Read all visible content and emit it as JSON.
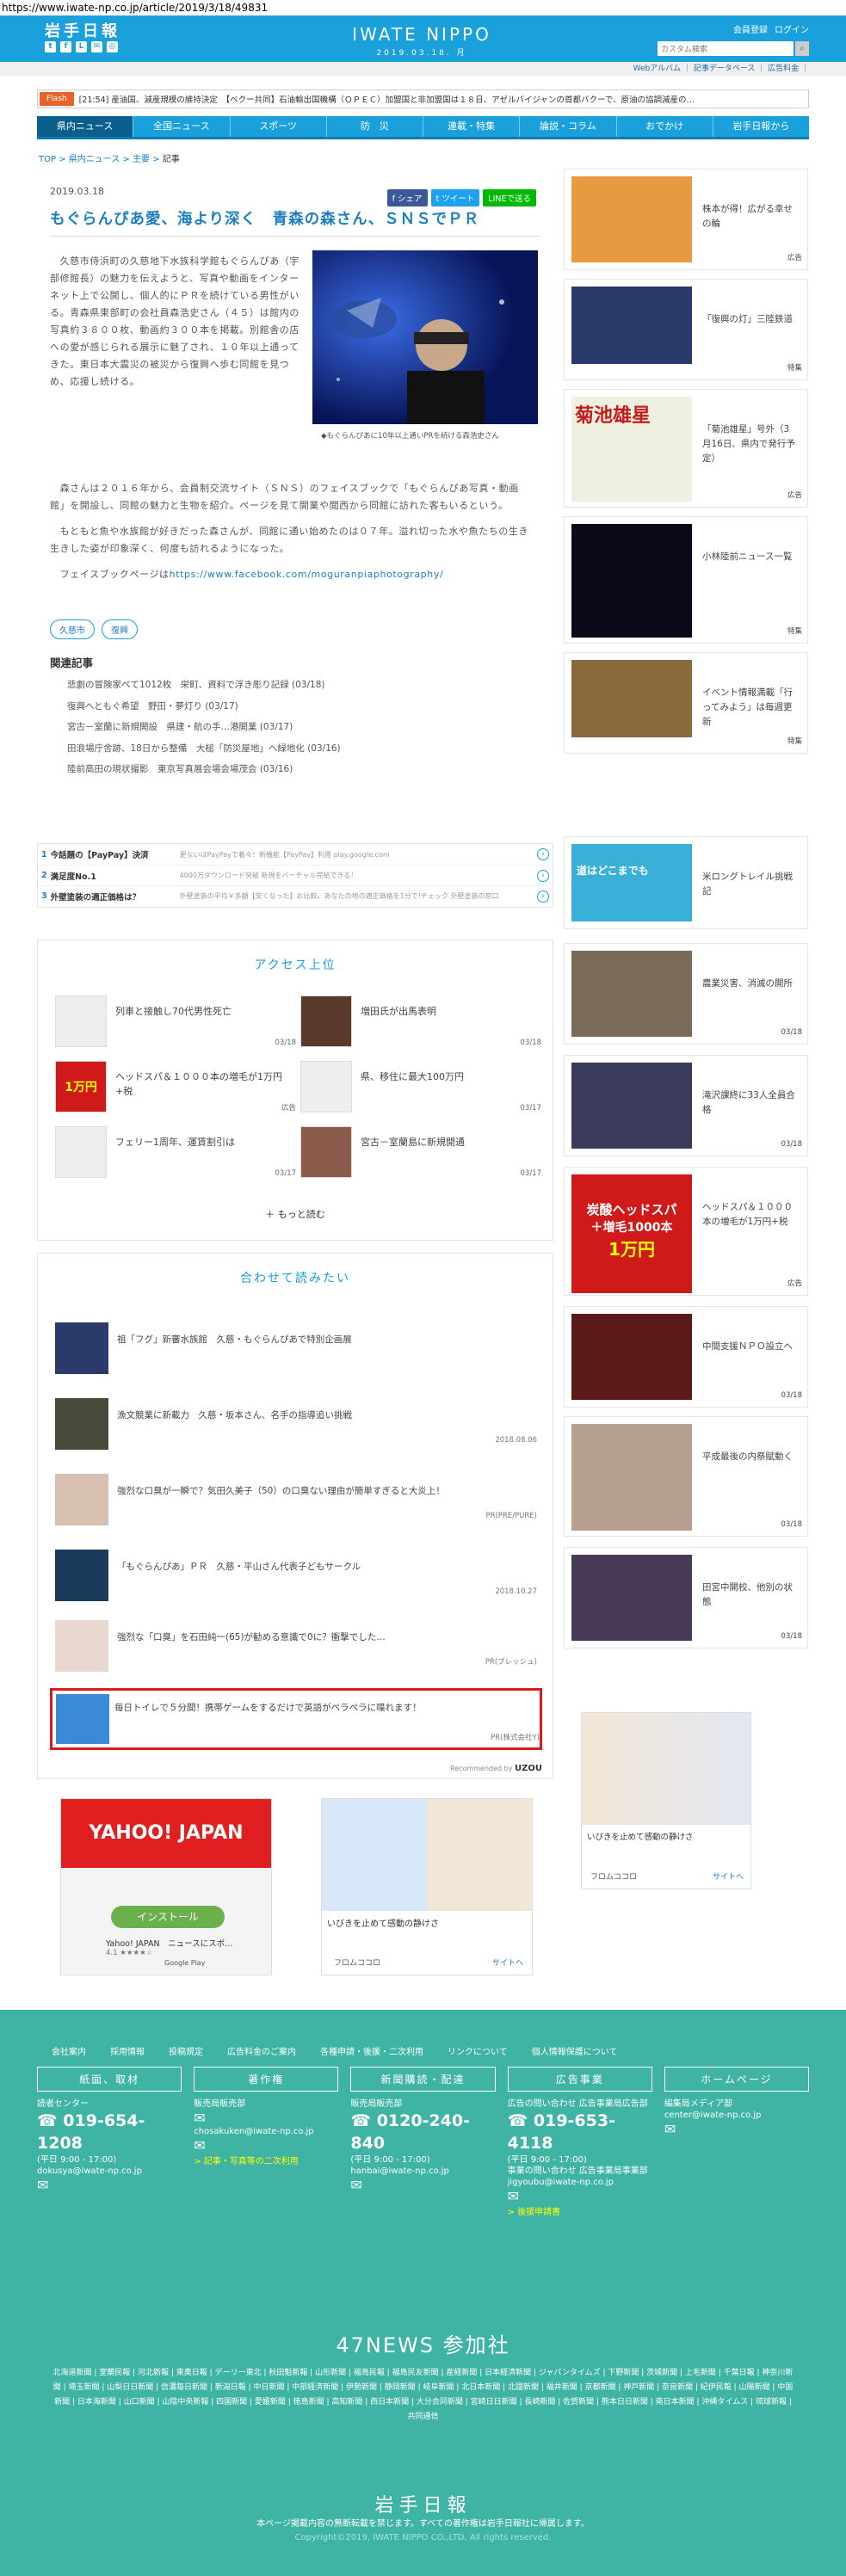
{
  "url": "https://www.iwate-np.co.jp/article/2019/3/18/49831",
  "header": {
    "logo": "岩手日報",
    "brand": "IWATE NIPPO",
    "date": "2019.03.18. 月",
    "links": [
      "会員登録",
      "ログイン"
    ],
    "search_placeholder": "カスタム検索",
    "sub_links": "Webアルバム ｜ 記事データベース ｜ 広告料金 ｜"
  },
  "flash": {
    "label": "Flash",
    "text": "[21:54] 産油国、減産規模の維持決定　【ベクー共同】石油輸出国機構（ＯＰＥＣ）加盟国と非加盟国は１８日、アゼルバイジャンの首都バクーで、原油の協調減産の…"
  },
  "nav": [
    "県内ニュース",
    "全国ニュース",
    "スポーツ",
    "防　災",
    "連載・特集",
    "論説・コラム",
    "おでかけ",
    "岩手日報から"
  ],
  "breadcrumb": {
    "top": "TOP",
    "sep": " > ",
    "area": "県内ニュース",
    "cat": "主要",
    "cur": "記事"
  },
  "article": {
    "date": "2019.03.18",
    "share": [
      "シェア",
      "ツイート",
      "LINEで送る"
    ],
    "title": "もぐらんぴあ愛、海より深く　青森の森さん、ＳＮＳでＰＲ",
    "caption": "◆もぐらんぴあに10年以上通いPRを続ける森浩史さん",
    "p1": "　久慈市侍浜町の久慈地下水族科学館もぐらんぴあ（宇部修館長）の魅力を伝えようと、写真や動画をインターネット上で公開し、個人的にＰＲを続けている男性がいる。青森県東部町の会社員森浩史さん（４５）は館内の写真約３８００枚、動画約３００本を掲載。別館舎の店への愛が感じられる展示に魅了され、１０年以上通ってきた。東日本大震災の被災から復興へ歩む同館を見つめ、応援し続ける。",
    "p2": "　森さんは２０１６年から、会員制交流サイト（ＳＮＳ）のフェイスブックで「もぐらんぴあ写真・動画館」を開設し、同館の魅力と生物を紹介。ページを見て開業や閲西から同館に訪れた客もいるという。",
    "p3": "　もともと魚や水族館が好きだった森さんが、同館に通い始めたのは０７年。溢れ切った水や魚たちの生き生きした姿が印象深く、何度も訪れるようになった。",
    "p4_prefix": "　フェイスブックページは",
    "p4_link": "https://www.facebook.com/moguranpiaphotography/",
    "tags": [
      "久慈市",
      "復興"
    ],
    "related_title": "関連記事",
    "related": [
      "悲劇の冒険家ペて1012枚　栄町、資料で浮き彫り記録 (03/18)",
      "復興へともぐ希望　野田・夢灯り (03/17)",
      "宮古－室蘭に新規開設　県建・航の手…港開業 (03/17)",
      "田浪場庁舎跡、18日から整備　大槌「防災屋地」へ緑地化 (03/16)",
      "陸前高田の現状撮影　東京写真展会場会場茂会 (03/16)"
    ]
  },
  "ad_strip": [
    {
      "n": "1",
      "t": "今話題の【PayPay】決済",
      "m": "更ないはPayPayで着々！新機能【PayPay】利用 play.google.com"
    },
    {
      "n": "2",
      "t": "満足度No.1",
      "m": "4000万ダウンロード突破 新規をバーチャル完結できる！"
    },
    {
      "n": "3",
      "t": "外壁塗装の適正価格は？",
      "m": "外壁塗装の平均￥多額【安くなった】お比較。あなたの地の適正価格を1分で!チェック 外壁塗装の窓口"
    }
  ],
  "access": {
    "title": "アクセス上位",
    "items": [
      {
        "t": "列車と接触し70代男性死亡",
        "d": "03/18"
      },
      {
        "t": "増田氏が出馬表明",
        "d": "03/18"
      },
      {
        "t": "ヘッドスパ＆１０００本の増毛が1万円+税",
        "d": "広告"
      },
      {
        "t": "県、移住に最大100万円",
        "d": "03/17"
      },
      {
        "t": "フェリー1周年、運賃割引は",
        "d": "03/17"
      },
      {
        "t": "宮古－室蘭島に新規開通",
        "d": "03/17"
      }
    ],
    "more": "＋ もっと読む",
    "ad_img_text": "1万円"
  },
  "together": {
    "title": "合わせて読みたい",
    "items": [
      {
        "t": "祖「フグ」新審水族館　久慈・もぐらんぴあで特別企画展",
        "d": ""
      },
      {
        "t": "漁文競業に新載力　久慈・坂本さん、名手の指導追い挑戦",
        "d": "2018.08.06"
      },
      {
        "t": "強烈な口臭が一瞬で？気田久美子（50）の口臭ない理由が簡単すぎると大炎上！",
        "d": "PR(PRE/PURE)"
      },
      {
        "t": "「もぐらんぴあ」ＰＲ　久慈・平山さん代表子どもサークル",
        "d": "2018.10.27"
      },
      {
        "t": "強烈な「口臭」を石田純一(65)が勧める意識で0に？衝撃でした…",
        "d": "PR(ブレッシュ)"
      },
      {
        "t": "毎日トイレで５分間！携帯ゲームをするだけで英語がペラペラに喋れます！",
        "d": "PR(株式会社Y)"
      }
    ],
    "powered": "Recommended by",
    "brand": "UZOU"
  },
  "bottom_ads": {
    "yahoo": "YAHOO! JAPAN",
    "install": "インストール",
    "app_name": "Yahoo! JAPAN　ニュースにスポ…",
    "rating": "4.1 ★★★★☆",
    "gp": "Google Play",
    "snore": "いびきを止めて感動の静けさ",
    "snore_brand": "フロムココロ",
    "snore_site": "サイトへ"
  },
  "sidebar": [
    {
      "t": "株本が得！広がる幸せの輪",
      "b": "広告"
    },
    {
      "t": "「復興の灯」三陸鉄道",
      "b": "特集"
    },
    {
      "t": "「菊池雄星」号外（3月16日、県内で発行予定）",
      "b": "広告"
    },
    {
      "t": "小林陸前ニュース一覧",
      "b": "特集"
    },
    {
      "t": "イベント情報満載「行ってみよう」は毎週更新",
      "b": "特集"
    },
    {
      "t": "米ロングトレイル挑戦記",
      "b": ""
    },
    {
      "t": "農業災害、消滅の開所",
      "b": "03/18"
    },
    {
      "t": "滝沢課終に33人全員合格",
      "b": "03/18"
    },
    {
      "t": "ヘッドスパ＆１０００本の増毛が1万円+税",
      "b": "広告"
    },
    {
      "t": "中間支援ＮＰＯ設立へ",
      "b": "03/18"
    },
    {
      "t": "平成最後の内祭賦動く",
      "b": "03/18"
    },
    {
      "t": "田宮中開校、他別の状態",
      "b": "03/18"
    }
  ],
  "side_img": {
    "kikuchi": "菊池雄星",
    "nanoka": "道はどこまでも",
    "headspa1": "炭酸ヘッドスパ",
    "headspa2": "＋増毛1000本",
    "headspa3": "1万円",
    "snore": "いびきを止めて感動の静けさ",
    "brand": "フロムココロ",
    "site": "サイトへ"
  },
  "footer": {
    "links": [
      "会社案内",
      "採用情報",
      "投稿規定",
      "広告料金のご案内",
      "各種申請・後援・二次利用",
      "リンクについて",
      "個人情報保護について"
    ],
    "cols": [
      {
        "hd": "紙面、取材",
        "a": "読者センター",
        "big": "019-654-1208",
        "hrs": "(平日 9:00 - 17:00)",
        "mail": "dokusya@iwate-np.co.jp",
        "y": ""
      },
      {
        "hd": "著作権",
        "a": "販売局販売部",
        "big": "",
        "hrs": "",
        "mail": "chosakuken@iwate-np.co.jp",
        "y": "> 記事・写真等の二次利用"
      },
      {
        "hd": "新聞購読・配達",
        "a": "販売局販売部",
        "big": "0120-240-840",
        "hrs": "(平日 9:00 - 17:00)",
        "mail": "hanbai@iwate-np.co.jp",
        "y": ""
      },
      {
        "hd": "広告事業",
        "a": "広告の問い合わせ 広告事業局広告部",
        "big": "019-653-4118",
        "hrs": "(平日 9:00 - 17:00)",
        "mail": "事業の問い合わせ 広告事業局事業部 jigyoubu@iwate-np.co.jp",
        "y": "> 後援申請書"
      },
      {
        "hd": "ホームページ",
        "a": "編集局メディア部",
        "big": "",
        "hrs": "",
        "mail": "center@iwate-np.co.jp",
        "y": ""
      }
    ],
    "news47": "47NEWS 参加社",
    "papers": "北海道新聞 | 室蘭民報 | 河北新報 | 東奥日報 | デーリー東北 | 秋田魁新報 | 山形新聞 | 福島民報 | 福島民友新聞 | 産経新聞 | 日本経済新聞 | ジャパンタイムズ | 下野新聞 | 茨城新聞 | 上毛新聞 | 千葉日報 | 神奈川新聞 | 埼玉新聞 | 山梨日日新聞 | 信濃毎日新聞 | 新潟日報 | 中日新聞 | 中部経済新聞 | 伊勢新聞 | 静岡新聞 | 岐阜新聞 | 北日本新聞 | 北國新聞 | 福井新聞 | 京都新聞 | 神戸新聞 | 奈良新聞 | 紀伊民報 | 山陽新聞 | 中国新聞 | 日本海新聞 | 山口新聞 | 山陰中央新報 | 四国新聞 | 愛媛新聞 | 徳島新聞 | 高知新聞 | 西日本新聞 | 大分合同新聞 | 宮崎日日新聞 | 長崎新聞 | 佐賀新聞 | 熊本日日新聞 | 南日本新聞 | 沖縄タイムス | 琉球新報 | 共同通信",
    "logo": "岩手日報",
    "note": "本ページ掲載内容の無断転載を禁じます。すべての著作権は岩手日報社に帰属します。",
    "copy": "Copyright©2019, IWATE NIPPO CO.,LTD. All rights reserved."
  }
}
